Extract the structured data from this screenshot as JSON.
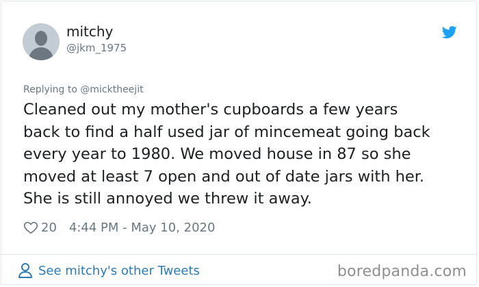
{
  "user": {
    "display_name": "mitchy",
    "handle": "@jkm_1975"
  },
  "reply": {
    "text": "Replying to @micktheejit"
  },
  "tweet": {
    "text": "Cleaned out my mother's cupboards a few years\nback to find a half used jar of mincemeat going back\nevery year to 1980. We moved house in 87 so she\nmoved at least 7 open and out of date jars with her.\nShe is still annoyed we threw it away.",
    "likes": "20",
    "timestamp": "4:44 PM - May 10, 2020"
  },
  "footer": {
    "see_more": "See mitchy's other Tweets",
    "watermark": "boredpanda.com"
  },
  "icons": {
    "avatar": "default-avatar-icon",
    "brand": "twitter-bird-icon",
    "like": "heart-icon",
    "profile": "person-icon"
  },
  "colors": {
    "text": "#1c2022",
    "secondary": "#697882",
    "link": "#2b7bb9",
    "twitter_blue": "#1da1f2",
    "border": "#e1e8ed"
  }
}
